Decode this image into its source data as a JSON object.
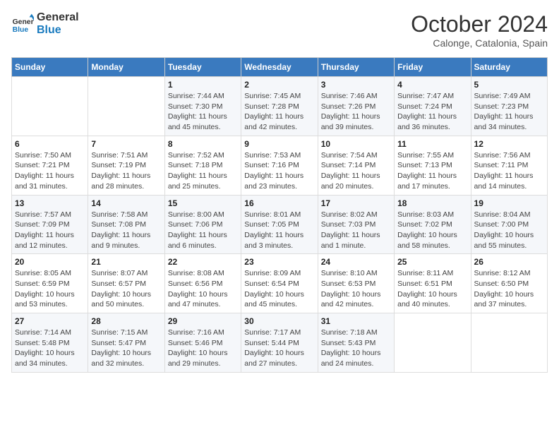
{
  "header": {
    "logo_line1": "General",
    "logo_line2": "Blue",
    "month": "October 2024",
    "location": "Calonge, Catalonia, Spain"
  },
  "weekdays": [
    "Sunday",
    "Monday",
    "Tuesday",
    "Wednesday",
    "Thursday",
    "Friday",
    "Saturday"
  ],
  "weeks": [
    [
      {
        "num": "",
        "sunrise": "",
        "sunset": "",
        "daylight": ""
      },
      {
        "num": "",
        "sunrise": "",
        "sunset": "",
        "daylight": ""
      },
      {
        "num": "1",
        "sunrise": "Sunrise: 7:44 AM",
        "sunset": "Sunset: 7:30 PM",
        "daylight": "Daylight: 11 hours and 45 minutes."
      },
      {
        "num": "2",
        "sunrise": "Sunrise: 7:45 AM",
        "sunset": "Sunset: 7:28 PM",
        "daylight": "Daylight: 11 hours and 42 minutes."
      },
      {
        "num": "3",
        "sunrise": "Sunrise: 7:46 AM",
        "sunset": "Sunset: 7:26 PM",
        "daylight": "Daylight: 11 hours and 39 minutes."
      },
      {
        "num": "4",
        "sunrise": "Sunrise: 7:47 AM",
        "sunset": "Sunset: 7:24 PM",
        "daylight": "Daylight: 11 hours and 36 minutes."
      },
      {
        "num": "5",
        "sunrise": "Sunrise: 7:49 AM",
        "sunset": "Sunset: 7:23 PM",
        "daylight": "Daylight: 11 hours and 34 minutes."
      }
    ],
    [
      {
        "num": "6",
        "sunrise": "Sunrise: 7:50 AM",
        "sunset": "Sunset: 7:21 PM",
        "daylight": "Daylight: 11 hours and 31 minutes."
      },
      {
        "num": "7",
        "sunrise": "Sunrise: 7:51 AM",
        "sunset": "Sunset: 7:19 PM",
        "daylight": "Daylight: 11 hours and 28 minutes."
      },
      {
        "num": "8",
        "sunrise": "Sunrise: 7:52 AM",
        "sunset": "Sunset: 7:18 PM",
        "daylight": "Daylight: 11 hours and 25 minutes."
      },
      {
        "num": "9",
        "sunrise": "Sunrise: 7:53 AM",
        "sunset": "Sunset: 7:16 PM",
        "daylight": "Daylight: 11 hours and 23 minutes."
      },
      {
        "num": "10",
        "sunrise": "Sunrise: 7:54 AM",
        "sunset": "Sunset: 7:14 PM",
        "daylight": "Daylight: 11 hours and 20 minutes."
      },
      {
        "num": "11",
        "sunrise": "Sunrise: 7:55 AM",
        "sunset": "Sunset: 7:13 PM",
        "daylight": "Daylight: 11 hours and 17 minutes."
      },
      {
        "num": "12",
        "sunrise": "Sunrise: 7:56 AM",
        "sunset": "Sunset: 7:11 PM",
        "daylight": "Daylight: 11 hours and 14 minutes."
      }
    ],
    [
      {
        "num": "13",
        "sunrise": "Sunrise: 7:57 AM",
        "sunset": "Sunset: 7:09 PM",
        "daylight": "Daylight: 11 hours and 12 minutes."
      },
      {
        "num": "14",
        "sunrise": "Sunrise: 7:58 AM",
        "sunset": "Sunset: 7:08 PM",
        "daylight": "Daylight: 11 hours and 9 minutes."
      },
      {
        "num": "15",
        "sunrise": "Sunrise: 8:00 AM",
        "sunset": "Sunset: 7:06 PM",
        "daylight": "Daylight: 11 hours and 6 minutes."
      },
      {
        "num": "16",
        "sunrise": "Sunrise: 8:01 AM",
        "sunset": "Sunset: 7:05 PM",
        "daylight": "Daylight: 11 hours and 3 minutes."
      },
      {
        "num": "17",
        "sunrise": "Sunrise: 8:02 AM",
        "sunset": "Sunset: 7:03 PM",
        "daylight": "Daylight: 11 hours and 1 minute."
      },
      {
        "num": "18",
        "sunrise": "Sunrise: 8:03 AM",
        "sunset": "Sunset: 7:02 PM",
        "daylight": "Daylight: 10 hours and 58 minutes."
      },
      {
        "num": "19",
        "sunrise": "Sunrise: 8:04 AM",
        "sunset": "Sunset: 7:00 PM",
        "daylight": "Daylight: 10 hours and 55 minutes."
      }
    ],
    [
      {
        "num": "20",
        "sunrise": "Sunrise: 8:05 AM",
        "sunset": "Sunset: 6:59 PM",
        "daylight": "Daylight: 10 hours and 53 minutes."
      },
      {
        "num": "21",
        "sunrise": "Sunrise: 8:07 AM",
        "sunset": "Sunset: 6:57 PM",
        "daylight": "Daylight: 10 hours and 50 minutes."
      },
      {
        "num": "22",
        "sunrise": "Sunrise: 8:08 AM",
        "sunset": "Sunset: 6:56 PM",
        "daylight": "Daylight: 10 hours and 47 minutes."
      },
      {
        "num": "23",
        "sunrise": "Sunrise: 8:09 AM",
        "sunset": "Sunset: 6:54 PM",
        "daylight": "Daylight: 10 hours and 45 minutes."
      },
      {
        "num": "24",
        "sunrise": "Sunrise: 8:10 AM",
        "sunset": "Sunset: 6:53 PM",
        "daylight": "Daylight: 10 hours and 42 minutes."
      },
      {
        "num": "25",
        "sunrise": "Sunrise: 8:11 AM",
        "sunset": "Sunset: 6:51 PM",
        "daylight": "Daylight: 10 hours and 40 minutes."
      },
      {
        "num": "26",
        "sunrise": "Sunrise: 8:12 AM",
        "sunset": "Sunset: 6:50 PM",
        "daylight": "Daylight: 10 hours and 37 minutes."
      }
    ],
    [
      {
        "num": "27",
        "sunrise": "Sunrise: 7:14 AM",
        "sunset": "Sunset: 5:48 PM",
        "daylight": "Daylight: 10 hours and 34 minutes."
      },
      {
        "num": "28",
        "sunrise": "Sunrise: 7:15 AM",
        "sunset": "Sunset: 5:47 PM",
        "daylight": "Daylight: 10 hours and 32 minutes."
      },
      {
        "num": "29",
        "sunrise": "Sunrise: 7:16 AM",
        "sunset": "Sunset: 5:46 PM",
        "daylight": "Daylight: 10 hours and 29 minutes."
      },
      {
        "num": "30",
        "sunrise": "Sunrise: 7:17 AM",
        "sunset": "Sunset: 5:44 PM",
        "daylight": "Daylight: 10 hours and 27 minutes."
      },
      {
        "num": "31",
        "sunrise": "Sunrise: 7:18 AM",
        "sunset": "Sunset: 5:43 PM",
        "daylight": "Daylight: 10 hours and 24 minutes."
      },
      {
        "num": "",
        "sunrise": "",
        "sunset": "",
        "daylight": ""
      },
      {
        "num": "",
        "sunrise": "",
        "sunset": "",
        "daylight": ""
      }
    ]
  ]
}
